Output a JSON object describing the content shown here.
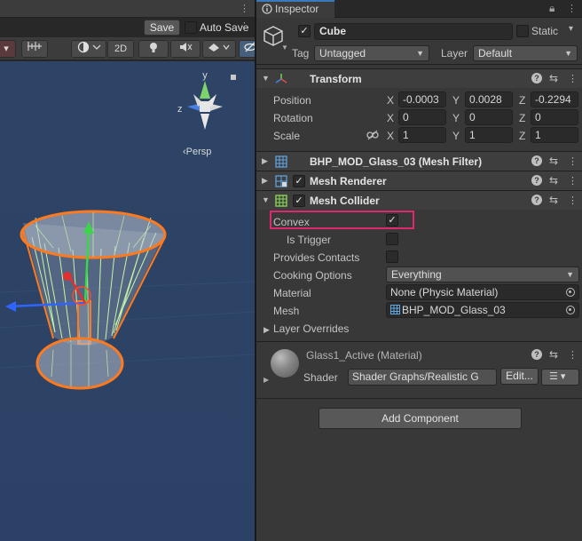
{
  "scene": {
    "save_label": "Save",
    "autosave_label": "Auto Save",
    "toolbar": {
      "mode_2d": "2D"
    },
    "persp_label": "‹Persp",
    "gizmo": {
      "y": "y",
      "z": "z"
    }
  },
  "inspector": {
    "tab_label": "Inspector",
    "object": {
      "name": "Cube",
      "active": true,
      "static_label": "Static",
      "tag_label": "Tag",
      "tag_value": "Untagged",
      "layer_label": "Layer",
      "layer_value": "Default"
    },
    "transform": {
      "title": "Transform",
      "position_label": "Position",
      "rotation_label": "Rotation",
      "scale_label": "Scale",
      "axis_x": "X",
      "axis_y": "Y",
      "axis_z": "Z",
      "position": {
        "x": "-0.0003",
        "y": "0.0028",
        "z": "-0.2294"
      },
      "rotation": {
        "x": "0",
        "y": "0",
        "z": "0"
      },
      "scale": {
        "x": "1",
        "y": "1",
        "z": "1"
      }
    },
    "mesh_filter": {
      "title": "BHP_MOD_Glass_03 (Mesh Filter)"
    },
    "mesh_renderer": {
      "title": "Mesh Renderer",
      "enabled": true
    },
    "mesh_collider": {
      "title": "Mesh Collider",
      "enabled": true,
      "convex_label": "Convex",
      "convex": true,
      "is_trigger_label": "Is Trigger",
      "is_trigger": false,
      "provides_contacts_label": "Provides Contacts",
      "provides_contacts": false,
      "cooking_options_label": "Cooking Options",
      "cooking_options_value": "Everything",
      "material_label": "Material",
      "material_value": "None (Physic Material)",
      "mesh_label": "Mesh",
      "mesh_value": "BHP_MOD_Glass_03",
      "layer_overrides_label": "Layer Overrides"
    },
    "material": {
      "name": "Glass1_Active (Material)",
      "shader_label": "Shader",
      "shader_value": "Shader Graphs/Realistic G",
      "edit_label": "Edit..."
    },
    "add_component_label": "Add Component"
  },
  "colors": {
    "highlight": "#e0286e",
    "selection_outline": "#ff7a1e",
    "viewport_bg": "#2c4366",
    "wireframe": "#b9f29a"
  }
}
